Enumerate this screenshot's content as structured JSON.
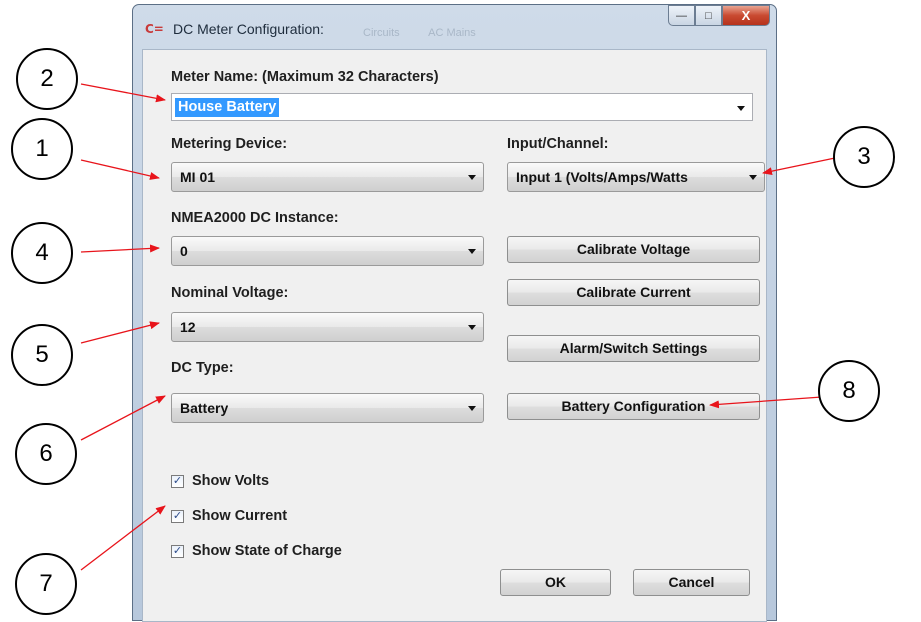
{
  "window": {
    "title": "DC Meter Configuration:",
    "icon": "c2-logo-icon",
    "background_tabs": [
      "Circuits",
      "AC Mains"
    ],
    "controls": {
      "minimize": "—",
      "maximize": "□",
      "close": "X"
    }
  },
  "form": {
    "meter_name_label": "Meter Name: (Maximum 32 Characters)",
    "meter_name_value": "House Battery",
    "metering_device_label": "Metering Device:",
    "metering_device_value": "MI 01",
    "input_channel_label": "Input/Channel:",
    "input_channel_value": "Input 1 (Volts/Amps/Watts",
    "nmea_instance_label": "NMEA2000 DC Instance:",
    "nmea_instance_value": "0",
    "nominal_voltage_label": "Nominal Voltage:",
    "nominal_voltage_value": "12",
    "dc_type_label": "DC Type:",
    "dc_type_value": "Battery"
  },
  "buttons": {
    "calibrate_voltage": "Calibrate Voltage",
    "calibrate_current": "Calibrate Current",
    "alarm_switch_settings": "Alarm/Switch Settings",
    "battery_configuration": "Battery Configuration",
    "ok": "OK",
    "cancel": "Cancel"
  },
  "checkboxes": [
    {
      "label": "Show Volts",
      "checked": true
    },
    {
      "label": "Show Current",
      "checked": true
    },
    {
      "label": "Show State of Charge",
      "checked": true
    }
  ],
  "callouts": [
    "1",
    "2",
    "3",
    "4",
    "5",
    "6",
    "7",
    "8"
  ],
  "colors": {
    "arrow": "#e8141b",
    "selection": "#3399ff",
    "close_button": "#c94a31"
  }
}
